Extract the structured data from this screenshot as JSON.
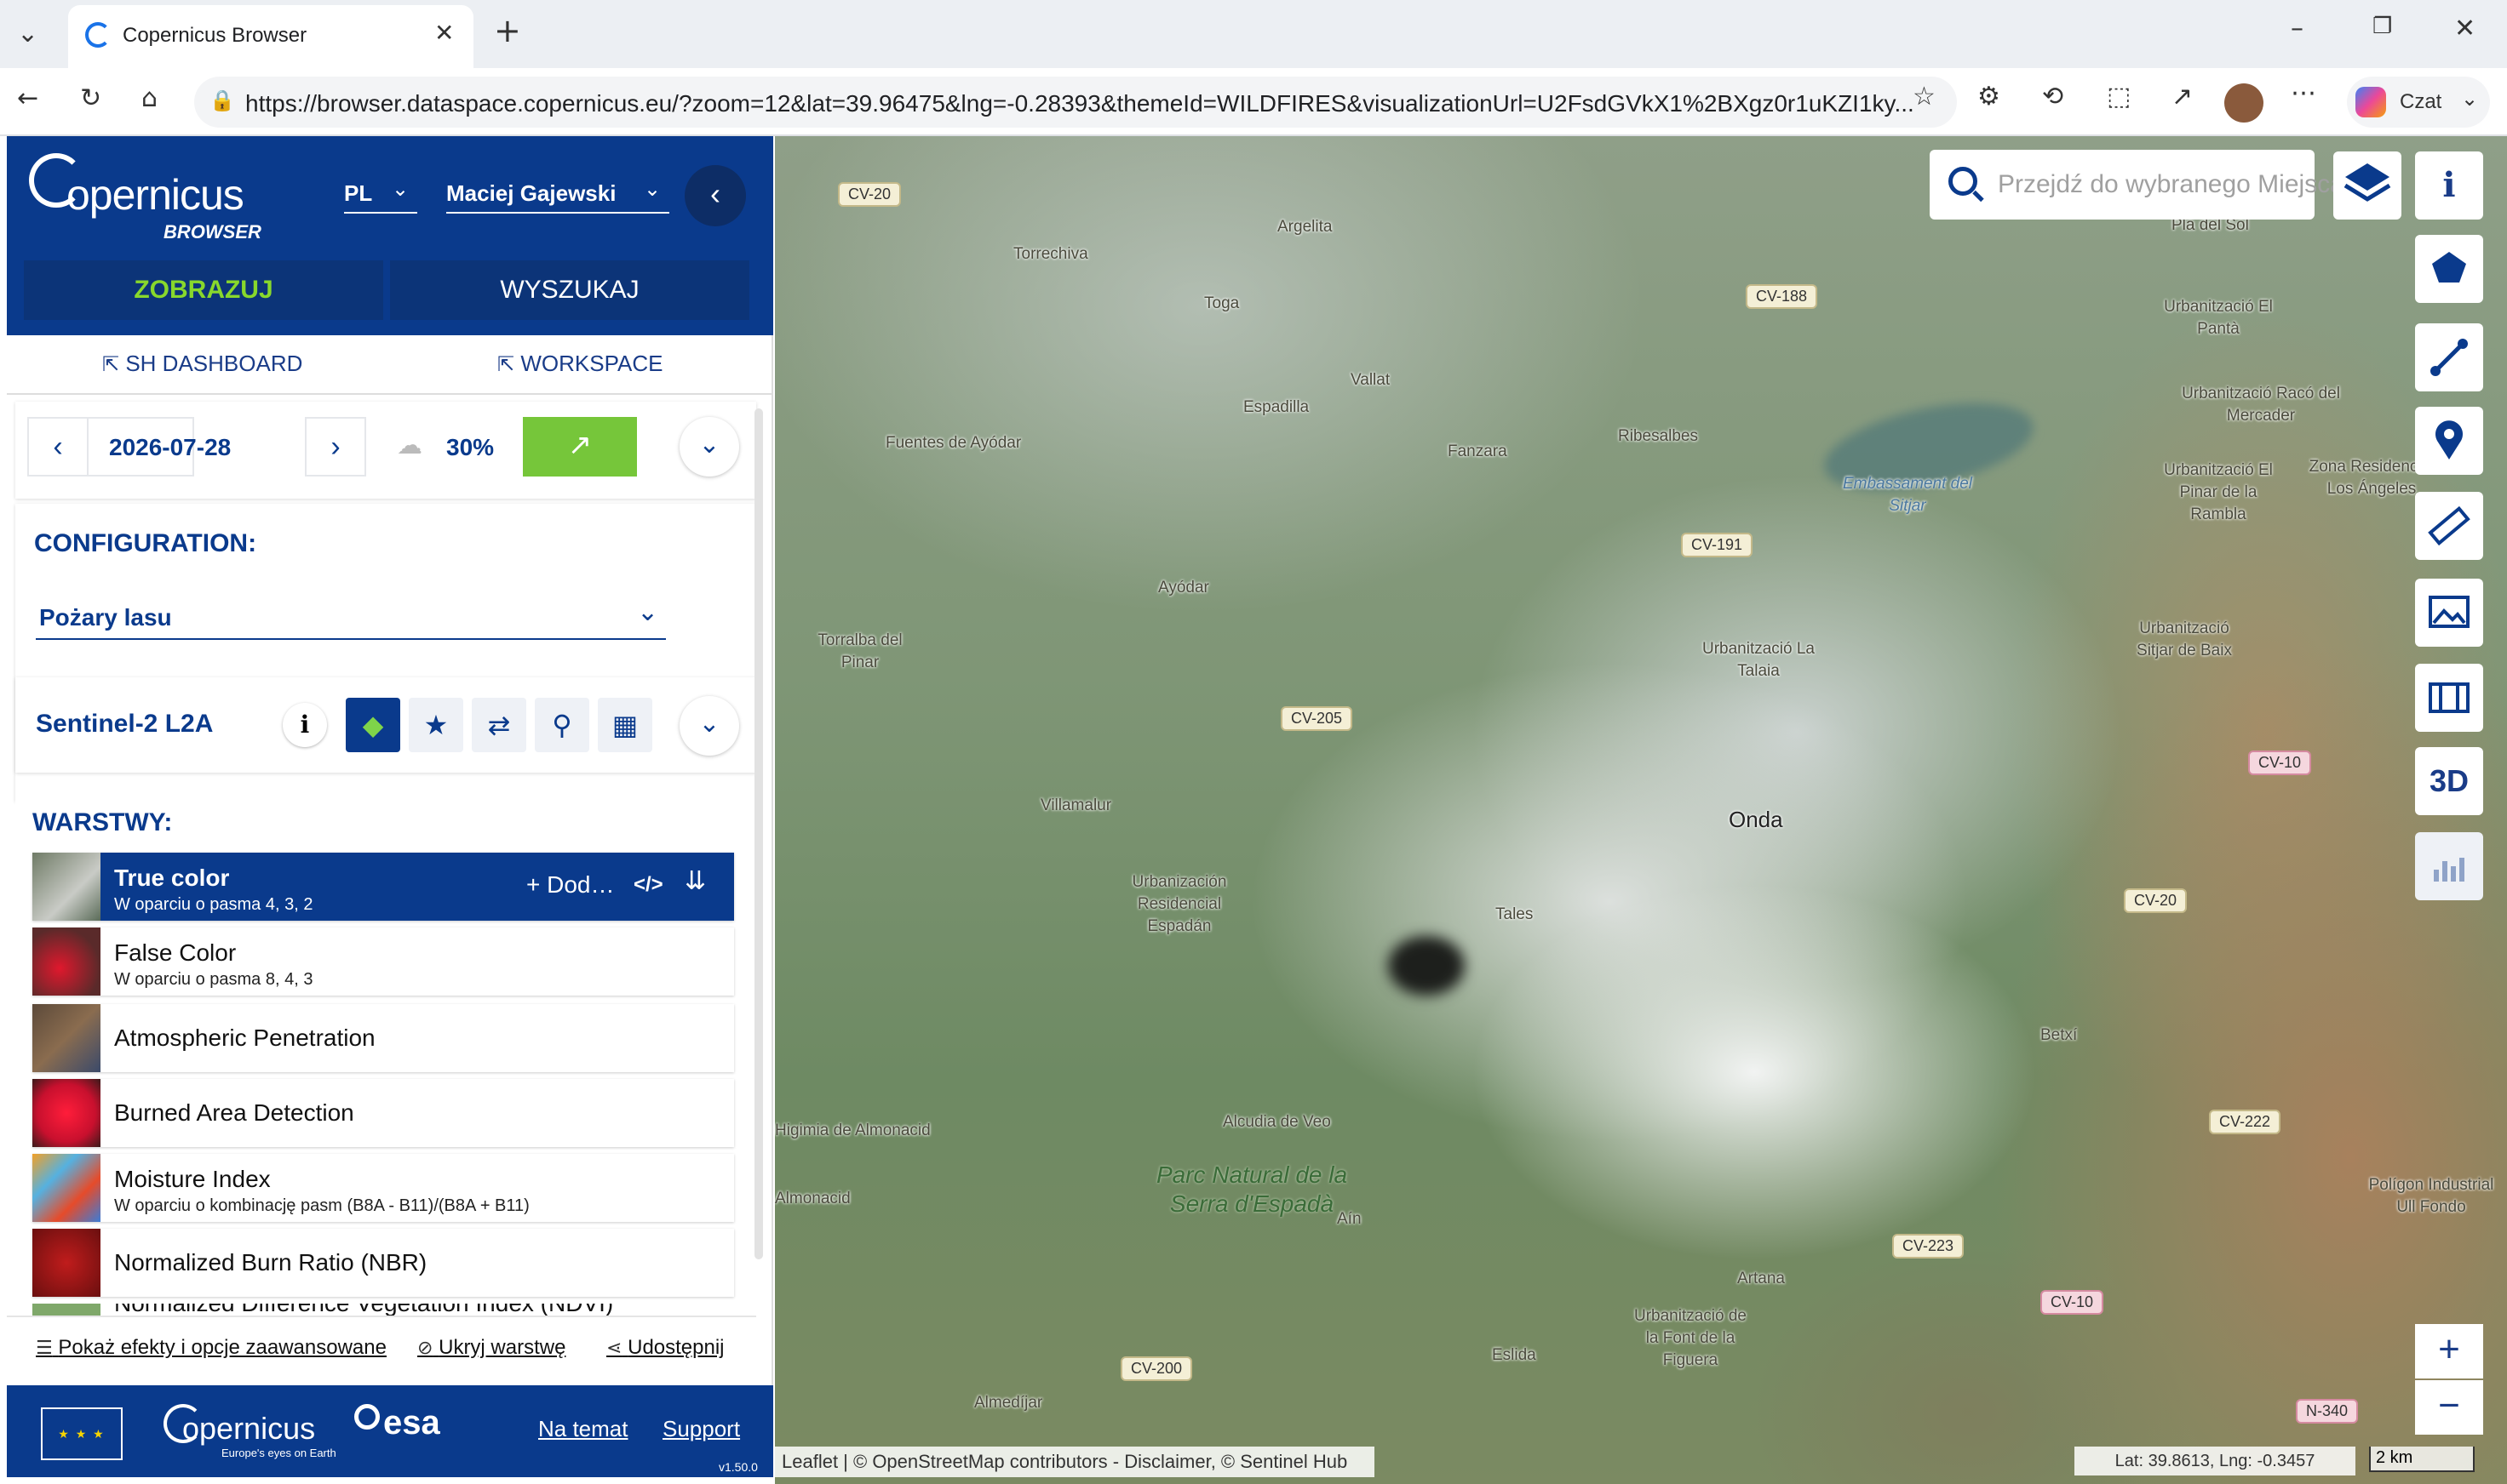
{
  "browser": {
    "tab_title": "Copernicus Browser",
    "url": "https://browser.dataspace.copernicus.eu/?zoom=12&lat=39.96475&lng=-0.28393&themeId=WILDFIRES&visualizationUrl=U2FsdGVkX1%2BXgz0r1uKZI1ky...",
    "copilot_label": "Czat"
  },
  "panel": {
    "brand": "opernicus",
    "brand_sub": "BROWSER",
    "lang": "PL",
    "user": "Maciej Gajewski",
    "tabs": {
      "visualize": "ZOBRAZUJ",
      "search": "WYSZUKAJ"
    },
    "links": {
      "dashboard": "SH DASHBOARD",
      "workspace": "WORKSPACE"
    },
    "date": "2026-07-28",
    "cloud": "30%",
    "config_heading": "CONFIGURATION:",
    "config_value": "Pożary lasu",
    "dataset": "Sentinel-2 L2A",
    "layers_heading": "WARSTWY:",
    "add_label": "Dod…",
    "layers": [
      {
        "name": "True color",
        "sub": "W oparciu o pasma 4, 3, 2"
      },
      {
        "name": "False Color",
        "sub": "W oparciu o pasma 8, 4, 3"
      },
      {
        "name": "Atmospheric Penetration",
        "sub": ""
      },
      {
        "name": "Burned Area Detection",
        "sub": ""
      },
      {
        "name": "Moisture Index",
        "sub": "W oparciu o kombinację pasm (B8A - B11)/(B8A + B11)"
      },
      {
        "name": "Normalized Burn Ratio (NBR)",
        "sub": ""
      },
      {
        "name": "Normalized Difference Vegetation Index (NDVI)",
        "sub": ""
      }
    ],
    "actions": {
      "effects": "Pokaż efekty i opcje zaawansowane",
      "hide": "Ukryj warstwę",
      "share": "Udostępnij"
    },
    "footer": {
      "copernicus": "opernicus",
      "copernicus_sub": "Europe's eyes on Earth",
      "esa": "esa",
      "about": "Na temat",
      "support": "Support",
      "version": "v1.50.0"
    }
  },
  "map": {
    "search_placeholder": "Przejdź do wybranego Miejsca",
    "attribution": "Leaflet | © OpenStreetMap contributors - Disclaimer, © Sentinel Hub",
    "latlng": "Lat: 39.8613, Lng: -0.3457",
    "scale": "2 km",
    "tool_3d": "3D",
    "places": [
      "Torrechiva",
      "Argelita",
      "Toga",
      "Vallat",
      "Espadilla",
      "Fuentes de Ayódar",
      "Fanzara",
      "Ribesalbes",
      "Ayódar",
      "Torralba del Pinar",
      "Villamalur",
      "Urbanización Residencial Espadán",
      "Tales",
      "Onda",
      "Alcudia de Veo",
      "Aín",
      "Betxí",
      "Artana",
      "Eslida",
      "Almedíjar",
      "Urbanització La Talaia",
      "Pla del Sol",
      "Urbanització El Pantà",
      "Urbanització Racó del Mercader",
      "Urbanització El Pinar de la Rambla",
      "Zona Residencial Los Ángeles",
      "Urbanització Sitjar de Baix",
      "Urbanització de la Font de la Figuera",
      "Polígon Industrial Ull Fondo",
      "Embassament del Sitjar",
      "Parc Natural de la Serra d'Espadà",
      "Higimia de Almonacid",
      "Almonacid"
    ],
    "roads": [
      "CV-20",
      "CV-188",
      "CV-191",
      "CV-205",
      "CV-10",
      "CV-20",
      "CV-222",
      "CV-223",
      "CV-10",
      "CV-200",
      "N-340"
    ]
  }
}
